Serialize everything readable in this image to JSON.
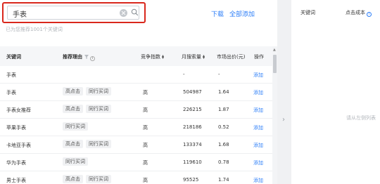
{
  "search": {
    "value": "手表"
  },
  "actions": {
    "download": "下载",
    "add_all": "全部添加"
  },
  "hint": "已为您推荐1001个关键词",
  "table": {
    "headers": {
      "keyword": "关键词",
      "reason": "推荐理由",
      "competition": "竞争指数",
      "volume": "月搜索量",
      "price": "市场出价(元)",
      "action": "操作"
    },
    "rows": [
      {
        "keyword": "手表",
        "tags": [],
        "competition": "",
        "volume": "-",
        "price": "-",
        "action": "添加"
      },
      {
        "keyword": "手表",
        "tags": [
          "高点击",
          "同行买词"
        ],
        "competition": "高",
        "volume": "504987",
        "price": "1.64",
        "action": "添加"
      },
      {
        "keyword": "手表女推荐",
        "tags": [
          "高点击",
          "同行买词"
        ],
        "competition": "高",
        "volume": "226215",
        "price": "1.87",
        "action": "添加"
      },
      {
        "keyword": "苹果手表",
        "tags": [
          "同行买词"
        ],
        "competition": "高",
        "volume": "218186",
        "price": "0.52",
        "action": "添加"
      },
      {
        "keyword": "卡地亚手表",
        "tags": [
          "高点击",
          "同行买词"
        ],
        "competition": "高",
        "volume": "133374",
        "price": "1.68",
        "action": "添加"
      },
      {
        "keyword": "华为手表",
        "tags": [
          "同行买词"
        ],
        "competition": "高",
        "volume": "119610",
        "price": "0.78",
        "action": "添加"
      },
      {
        "keyword": "男士手表",
        "tags": [
          "高点击",
          "同行买词"
        ],
        "competition": "高",
        "volume": "95525",
        "price": "1.74",
        "action": "添加"
      }
    ]
  },
  "right_panel": {
    "col_keyword": "关键词",
    "col_cost": "点击成本",
    "empty_text": "请从左侧列表"
  },
  "colors": {
    "accent": "#2c7ef8",
    "highlight_border": "#d9271c"
  }
}
